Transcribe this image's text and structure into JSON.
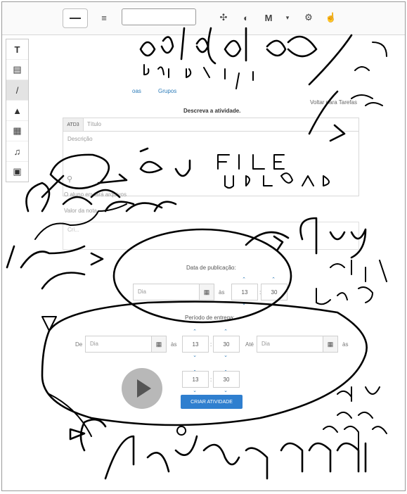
{
  "toolbar": {
    "weight_label": "≡",
    "move_icon": "move-icon",
    "eraser_icon": "eraser-icon",
    "m_label": "M",
    "settings_icon": "gear-icon",
    "hand_icon": "hand-icon"
  },
  "palette": {
    "items": [
      "T",
      "▤",
      "/",
      "▲",
      "▦",
      "♫",
      "▣"
    ]
  },
  "app": {
    "tab_partial": "oas",
    "tab_grupos": "Grupos",
    "back_link": "Voltar para Tarefas",
    "section_title": "Descreva a atividade.",
    "atv_label": "ATD3",
    "titulo_placeholder": "Título",
    "descricao_placeholder": "Descrição",
    "aluno_check": "O aluno enviará arquivos",
    "nota_label": "Valor da nota",
    "publicacao_title": "Data de publicação:",
    "date_placeholder": "Dia",
    "as_label": "às",
    "colon": ":",
    "pub_hour": "13",
    "pub_minute": "30",
    "entrega_title": "Período de entrega:",
    "de_label": "De",
    "ate_label": "Até",
    "ent_start_hour": "13",
    "ent_start_minute": "30",
    "ent_end_hour": "13",
    "ent_end_minute": "30",
    "criar_button": "CRIAR ATIVIDADE"
  },
  "colors": {
    "accent_blue": "#2f7fcf",
    "ink": "#000000"
  }
}
